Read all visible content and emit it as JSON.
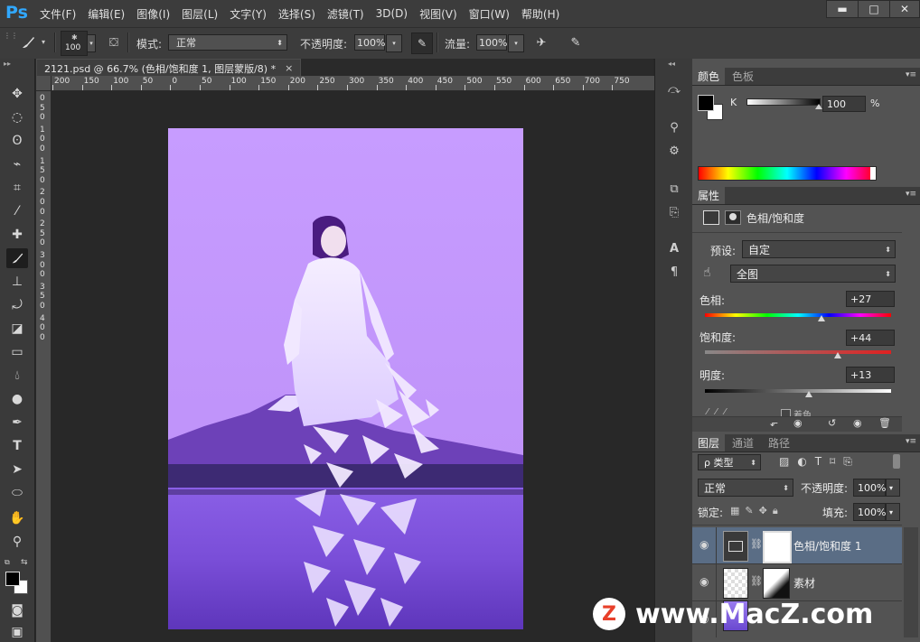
{
  "app": {
    "logo": "Ps"
  },
  "menu": [
    "文件(F)",
    "编辑(E)",
    "图像(I)",
    "图层(L)",
    "文字(Y)",
    "选择(S)",
    "滤镜(T)",
    "3D(D)",
    "视图(V)",
    "窗口(W)",
    "帮助(H)"
  ],
  "window_controls": {
    "minimize": "▬",
    "maximize": "□",
    "close": "✕"
  },
  "options": {
    "brush_size": "100",
    "mode_label": "模式:",
    "mode_value": "正常",
    "opacity_label": "不透明度:",
    "opacity_value": "100%",
    "flow_label": "流量:",
    "flow_value": "100%"
  },
  "document": {
    "tab_title": "2121.psd @ 66.7% (色相/饱和度 1, 图层蒙版/8) *",
    "close_glyph": "×",
    "ruler_top": [
      "200",
      "150",
      "100",
      "50",
      "0",
      "50",
      "100",
      "150",
      "200",
      "250",
      "300",
      "350",
      "400",
      "450",
      "500",
      "550",
      "600",
      "650",
      "700",
      "750"
    ],
    "ruler_left": [
      "0",
      "5",
      "0",
      "1",
      "0",
      "0",
      "1",
      "5",
      "0",
      "2",
      "0",
      "0",
      "2",
      "5",
      "0",
      "3",
      "0",
      "0",
      "3",
      "5",
      "0",
      "4",
      "0",
      "0"
    ]
  },
  "color_panel": {
    "tabs": [
      "颜色",
      "色板"
    ],
    "channel_label": "K",
    "k_value": "100",
    "unit": "%",
    "k_level_percent": 100
  },
  "properties_panel": {
    "tab": "属性",
    "title": "色相/饱和度",
    "preset_label": "预设:",
    "preset_value": "自定",
    "channel_value": "全图",
    "hue_label": "色相:",
    "hue_value": "+27",
    "saturation_label": "饱和度:",
    "saturation_value": "+44",
    "lightness_label": "明度:",
    "lightness_value": "+13",
    "colorize_label": "着色"
  },
  "layers_panel": {
    "tabs": [
      "图层",
      "通道",
      "路径"
    ],
    "filter_label": "ρ 类型",
    "blend_mode": "正常",
    "opacity_label": "不透明度:",
    "opacity_value": "100%",
    "lock_label": "锁定:",
    "fill_label": "填充:",
    "fill_value": "100%",
    "layers": [
      {
        "name": "色相/饱和度 1",
        "selected": true
      },
      {
        "name": "素材",
        "selected": false
      },
      {
        "name": "",
        "selected": false
      }
    ]
  },
  "watermark": {
    "text": "www.MacZ.com",
    "badge": "Z"
  },
  "colors": {
    "canvas_purple": "#c296ff",
    "accent_blue": "#31a8ff",
    "watermark_red": "#e8402a"
  }
}
